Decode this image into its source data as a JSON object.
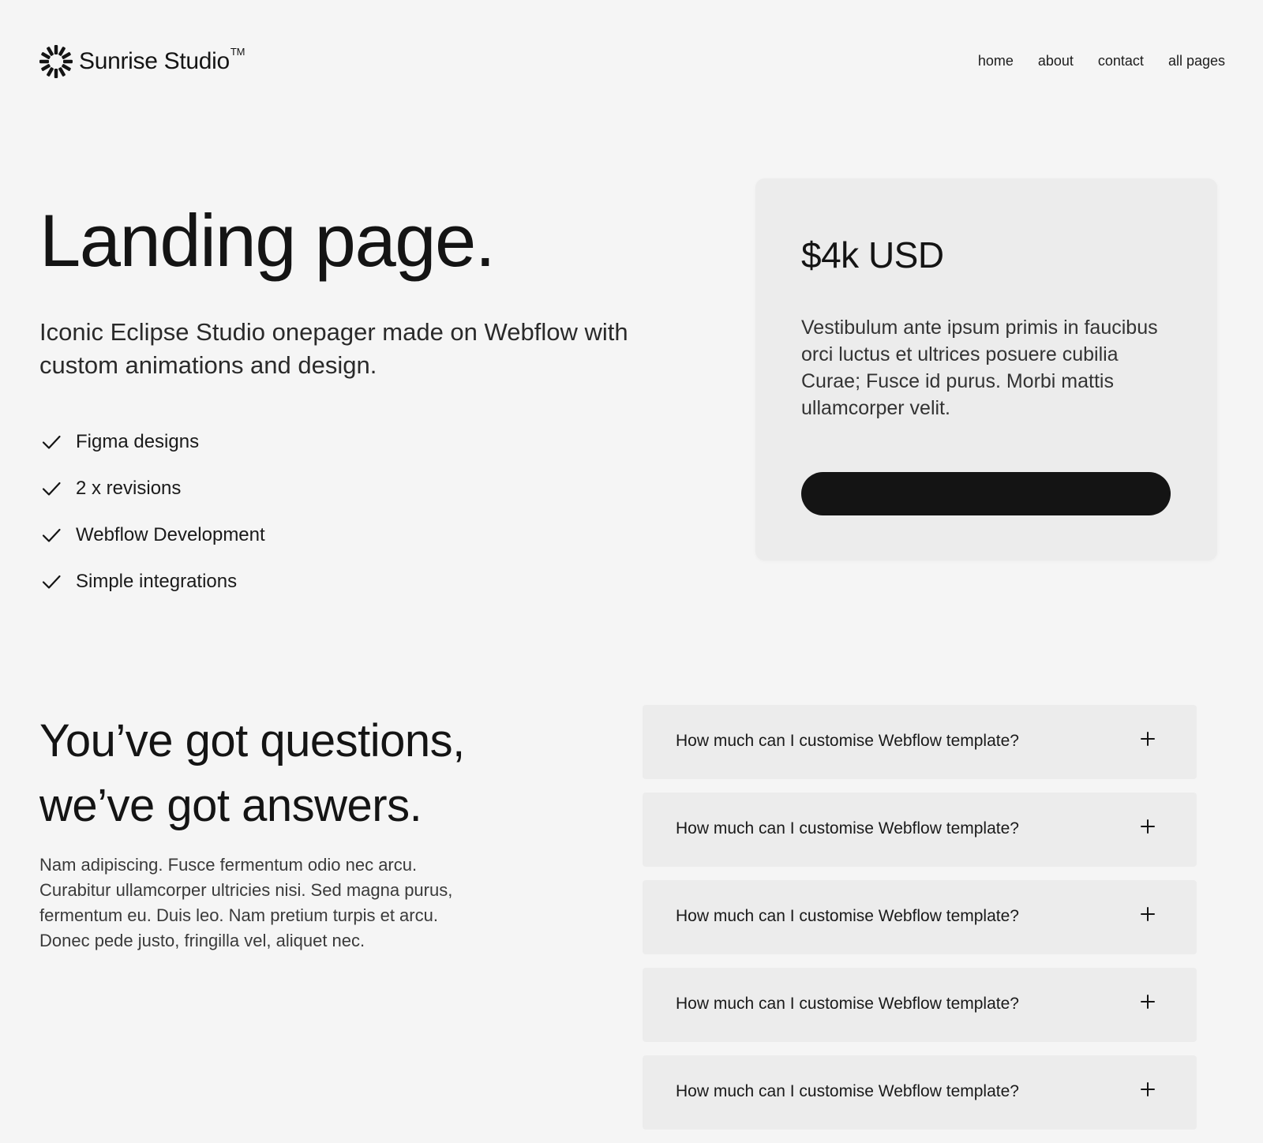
{
  "header": {
    "brand": {
      "name": "Sunrise Studio",
      "trademark": "TM",
      "logo_icon": "sunburst-icon"
    },
    "nav": [
      {
        "label": "home"
      },
      {
        "label": "about"
      },
      {
        "label": "contact"
      },
      {
        "label": "all pages"
      }
    ]
  },
  "hero": {
    "title": "Landing page.",
    "subtitle": "Iconic Eclipse Studio onepager made on Webflow with custom animations and design.",
    "features": [
      {
        "icon": "check-icon",
        "label": "Figma designs"
      },
      {
        "icon": "check-icon",
        "label": "2 x revisions"
      },
      {
        "icon": "check-icon",
        "label": "Webflow Development"
      },
      {
        "icon": "check-icon",
        "label": "Simple integrations"
      }
    ]
  },
  "pricing": {
    "price": "$4k USD",
    "description": "Vestibulum ante ipsum primis in faucibus orci luctus et ultrices posuere cubilia Curae; Fusce id purus. Morbi mattis ullamcorper velit.",
    "button_label": ""
  },
  "faq": {
    "title_line1": "You’ve got questions,",
    "title_line2": "we’ve got answers.",
    "description": "Nam adipiscing. Fusce fermentum odio nec arcu. Curabitur ullamcorper ultricies nisi. Sed magna purus, fermentum eu. Duis leo. Nam pretium turpis et arcu. Donec pede justo, fringilla vel, aliquet nec.",
    "items": [
      {
        "question": "How much can I customise Webflow template?",
        "icon": "plus-icon"
      },
      {
        "question": "How much can I customise Webflow template?",
        "icon": "plus-icon"
      },
      {
        "question": "How much can I customise Webflow template?",
        "icon": "plus-icon"
      },
      {
        "question": "How much can I customise Webflow template?",
        "icon": "plus-icon"
      },
      {
        "question": "How much can I customise Webflow template?",
        "icon": "plus-icon"
      }
    ]
  },
  "colors": {
    "background": "#f5f5f5",
    "card": "#ececec",
    "text": "#141414",
    "button": "#141414"
  }
}
